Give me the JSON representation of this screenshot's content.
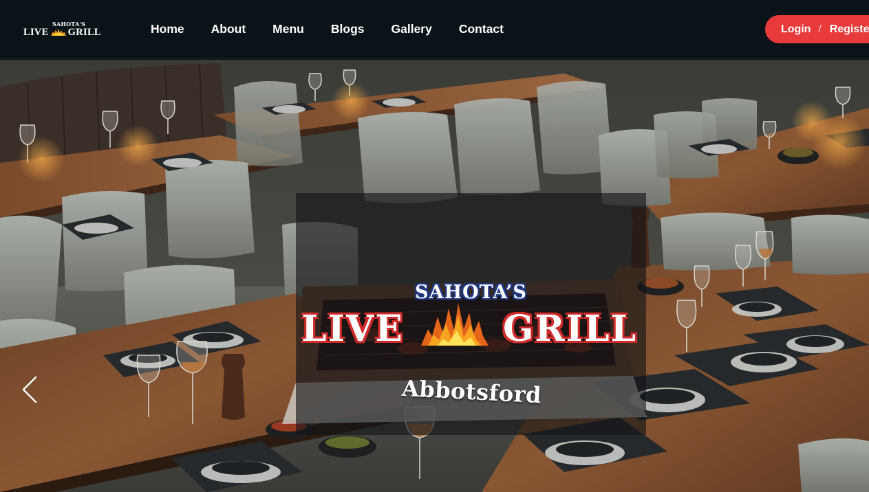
{
  "brand": {
    "logo_top": "SAHOTA'S",
    "logo_word_left": "LIVE",
    "logo_word_right": "GRILL"
  },
  "nav": {
    "items": [
      {
        "label": "Home"
      },
      {
        "label": "About"
      },
      {
        "label": "Menu"
      },
      {
        "label": "Blogs"
      },
      {
        "label": "Gallery"
      },
      {
        "label": "Contact"
      }
    ]
  },
  "auth": {
    "login_label": "Login",
    "separator": "/",
    "register_label": "Register"
  },
  "hero": {
    "title_top": "SAHOTA’S",
    "title_left": "LIVE",
    "title_right": "GRILL",
    "location": "Abbotsford",
    "prev_arrow_icon": "chevron-left-icon"
  },
  "colors": {
    "nav_background": "#0a1317",
    "accent_red": "#e83a3a",
    "logo_outline_blue": "#1f3a8a",
    "logo_outline_red": "#d02a2a"
  }
}
